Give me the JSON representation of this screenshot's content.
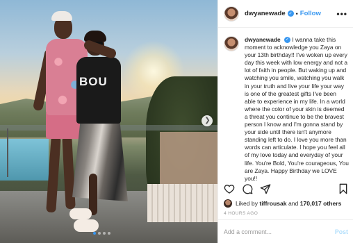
{
  "post": {
    "username": "dwyanewade",
    "verified_icon": "verified-badge-icon",
    "separator": "•",
    "follow_label": "Follow",
    "more_icon": "•••",
    "caption_username": "dwyanewade",
    "caption": "I wanna take this moment to acknowledge you Zaya on your 13th birthday!! I've woken up every day this week with low energy and not a lot of faith in people. But waking up and watching you smile, watching you walk in your truth and live your life your way is one of the greatest gifts I've been able to experience in my life. In a world where the color of your skin is deemed a threat you continue to be the bravest person I know and I'm gonna stand by your side until there isn't anymore standing left to do. I love you more than words can articulate. I hope you feel all of my love today and everyday of your life. You're Bold, You're courageous, You are Zaya. Happy Birthday we LOVE you!!",
    "liked_by_prefix": "Liked by",
    "liked_by_user": "tiffrousak",
    "liked_by_and": "and",
    "liked_by_others": "170,017 others",
    "time_ago": "4 HOURS AGO",
    "comment_placeholder": "Add a comment...",
    "post_label": "Post",
    "photo_shirt_text": "BOU",
    "carousel": {
      "count": 4,
      "active_index": 0
    },
    "colors": {
      "accent": "#3897f0",
      "post_disabled": "#b2dffc",
      "muted": "#999999"
    }
  }
}
